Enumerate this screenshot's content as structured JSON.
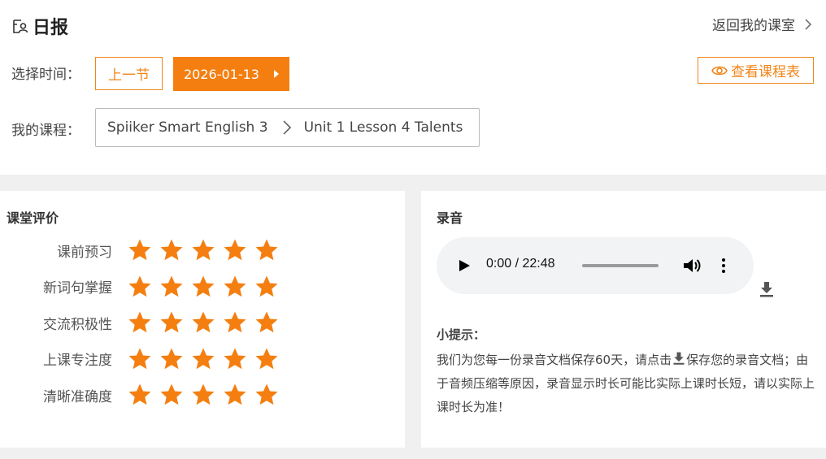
{
  "header": {
    "title": "日报",
    "back_link": "返回我的课室"
  },
  "selector": {
    "time_label": "选择时间：",
    "prev_button": "上一节",
    "date_button": "2026-01-13",
    "schedule_button": "查看课程表"
  },
  "course": {
    "label": "我的课程：",
    "book": "Spiiker Smart English 3",
    "lesson": "Unit 1 Lesson 4 Talents"
  },
  "evaluation": {
    "title": "课堂评价",
    "items": [
      {
        "label": "课前预习",
        "stars": 5,
        "max": 5
      },
      {
        "label": "新词句掌握",
        "stars": 5,
        "max": 5
      },
      {
        "label": "交流积极性",
        "stars": 5,
        "max": 5
      },
      {
        "label": "上课专注度",
        "stars": 5,
        "max": 5
      },
      {
        "label": "清晰准确度",
        "stars": 5,
        "max": 5
      }
    ]
  },
  "recording": {
    "title": "录音",
    "time_display": "0:00 / 22:48",
    "progress": 0,
    "tip_title": "小提示：",
    "tip_part1": "我们为您每一份录音文档保存60天，请点击",
    "tip_part2": "保存您的录音文档；由于音频压缩等原因，录音显示时长可能比实际上课时长短，请以实际上课时长为准！"
  },
  "colors": {
    "accent": "#f47f10",
    "star": "#f47f10"
  },
  "icons": {
    "title": "report-icon",
    "back": "chevron-right-icon",
    "schedule": "eye-icon",
    "separator": "chevron-right-icon",
    "star": "star-icon",
    "play": "play-icon",
    "volume": "volume-icon",
    "more": "more-vertical-icon",
    "download": "download-icon"
  }
}
